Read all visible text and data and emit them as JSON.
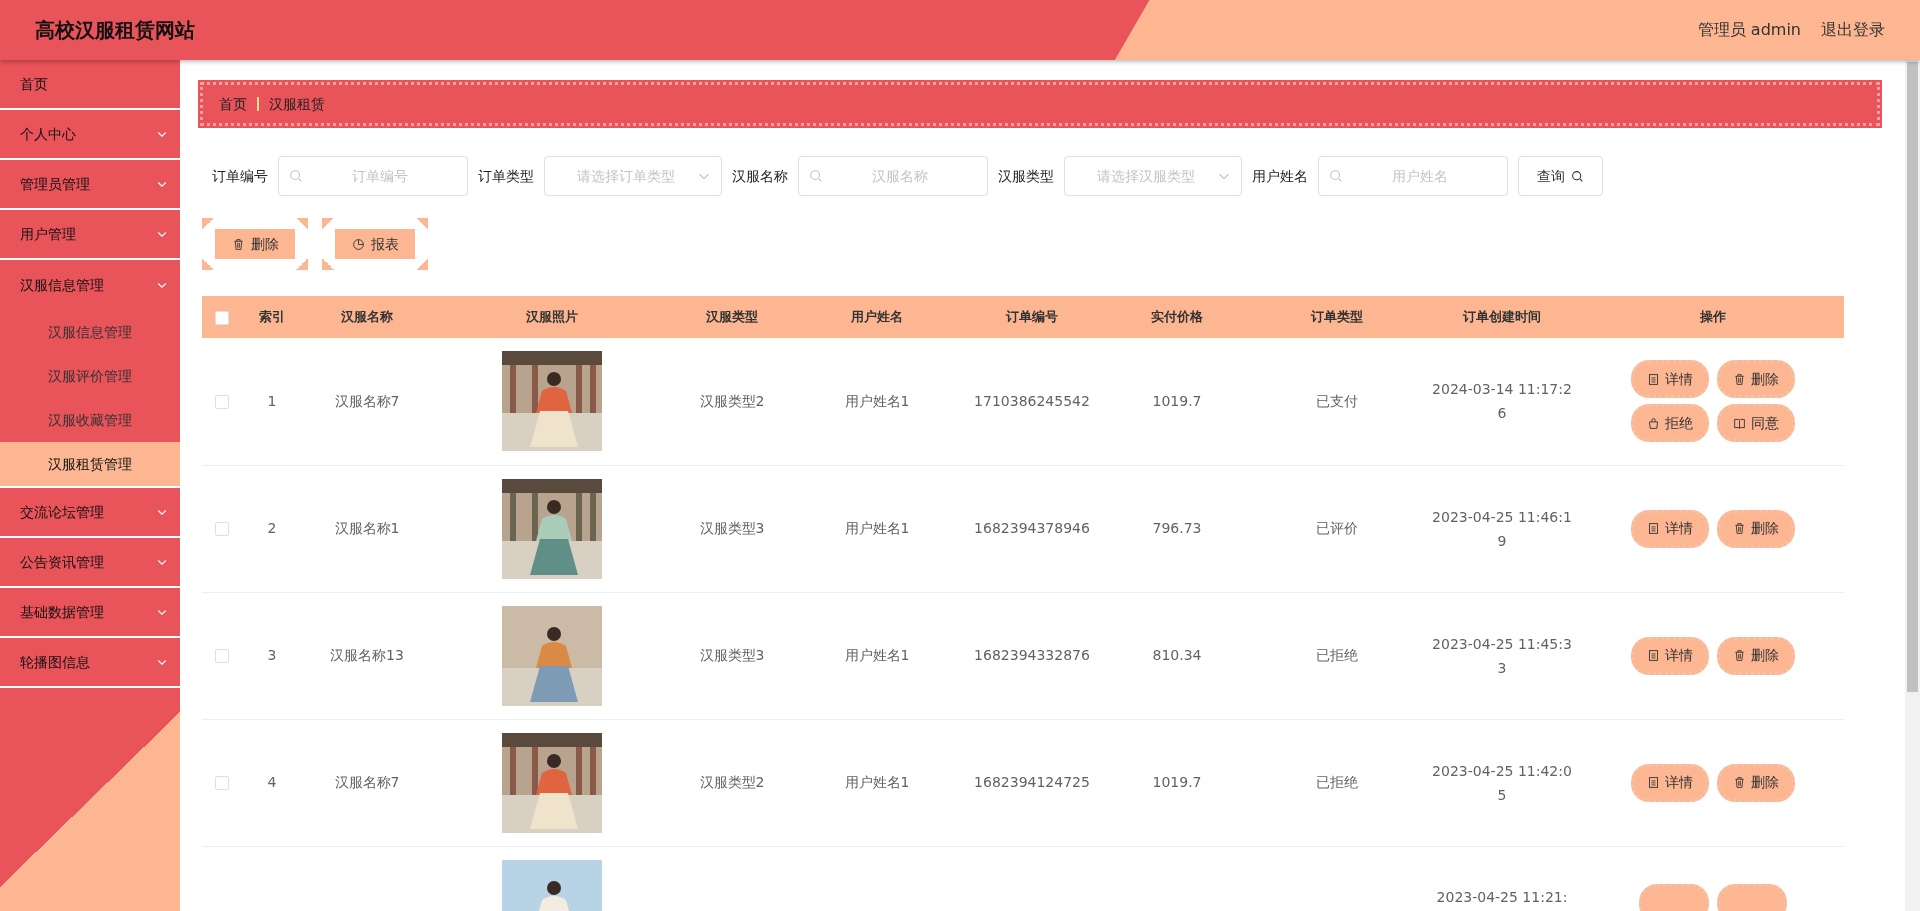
{
  "header": {
    "title": "高校汉服租赁网站",
    "user_label": "管理员 admin",
    "logout": "退出登录"
  },
  "sidebar": {
    "items": [
      {
        "label": "首页",
        "kind": "link",
        "selected": false
      },
      {
        "label": "个人中心",
        "kind": "menu",
        "selected": false
      },
      {
        "label": "管理员管理",
        "kind": "menu",
        "selected": false
      },
      {
        "label": "用户管理",
        "kind": "menu",
        "selected": false
      },
      {
        "label": "汉服信息管理",
        "kind": "menu",
        "expanded": true,
        "selected": false,
        "children": [
          {
            "label": "汉服信息管理",
            "selected": false
          },
          {
            "label": "汉服评价管理",
            "selected": false
          },
          {
            "label": "汉服收藏管理",
            "selected": false
          },
          {
            "label": "汉服租赁管理",
            "selected": true
          }
        ]
      },
      {
        "label": "交流论坛管理",
        "kind": "menu",
        "selected": false
      },
      {
        "label": "公告资讯管理",
        "kind": "menu",
        "selected": false
      },
      {
        "label": "基础数据管理",
        "kind": "menu",
        "selected": false
      },
      {
        "label": "轮播图信息",
        "kind": "menu",
        "selected": false
      }
    ]
  },
  "breadcrumb": [
    "首页",
    "汉服租赁"
  ],
  "filters": [
    {
      "label": "订单编号",
      "kind": "input",
      "placeholder": "订单编号"
    },
    {
      "label": "订单类型",
      "kind": "select",
      "placeholder": "请选择订单类型"
    },
    {
      "label": "汉服名称",
      "kind": "input",
      "placeholder": "汉服名称"
    },
    {
      "label": "汉服类型",
      "kind": "select",
      "placeholder": "请选择汉服类型"
    },
    {
      "label": "用户姓名",
      "kind": "input",
      "placeholder": "用户姓名"
    }
  ],
  "query_button": "查询",
  "toolbar": [
    {
      "kind": "delete",
      "label": "删除"
    },
    {
      "kind": "chart",
      "label": "报表"
    }
  ],
  "table": {
    "select_all": {
      "checked": false
    },
    "columns": [
      "索引",
      "汉服名称",
      "汉服照片",
      "汉服类型",
      "用户姓名",
      "订单编号",
      "实付价格",
      "订单类型",
      "订单创建时间",
      "操作"
    ],
    "rows": [
      {
        "checked": false,
        "index": "1",
        "name": "汉服名称7",
        "type": "汉服类型2",
        "user": "用户姓名1",
        "order_no": "1710386245542",
        "price": "1019.7",
        "order_type": "已支付",
        "created": "2024-03-14 11:17:26",
        "actions": [
          {
            "kind": "detail",
            "label": "详情"
          },
          {
            "kind": "delete",
            "label": "删除"
          },
          {
            "kind": "reject",
            "label": "拒绝"
          },
          {
            "kind": "agree",
            "label": "同意"
          }
        ]
      },
      {
        "checked": false,
        "index": "2",
        "name": "汉服名称1",
        "type": "汉服类型3",
        "user": "用户姓名1",
        "order_no": "1682394378946",
        "price": "796.73",
        "order_type": "已评价",
        "created": "2023-04-25 11:46:19",
        "actions": [
          {
            "kind": "detail",
            "label": "详情"
          },
          {
            "kind": "delete",
            "label": "删除"
          }
        ]
      },
      {
        "checked": false,
        "index": "3",
        "name": "汉服名称13",
        "type": "汉服类型3",
        "user": "用户姓名1",
        "order_no": "1682394332876",
        "price": "810.34",
        "order_type": "已拒绝",
        "created": "2023-04-25 11:45:33",
        "actions": [
          {
            "kind": "detail",
            "label": "详情"
          },
          {
            "kind": "delete",
            "label": "删除"
          }
        ]
      },
      {
        "checked": false,
        "index": "4",
        "name": "汉服名称7",
        "type": "汉服类型2",
        "user": "用户姓名1",
        "order_no": "1682394124725",
        "price": "1019.7",
        "order_type": "已拒绝",
        "created": "2023-04-25 11:42:05",
        "actions": [
          {
            "kind": "detail",
            "label": "详情"
          },
          {
            "kind": "delete",
            "label": "删除"
          }
        ]
      },
      {
        "created": "2023-04-25 11:21:",
        "actions": [
          {
            "kind": "detail"
          },
          {
            "kind": "delete"
          }
        ]
      }
    ]
  }
}
